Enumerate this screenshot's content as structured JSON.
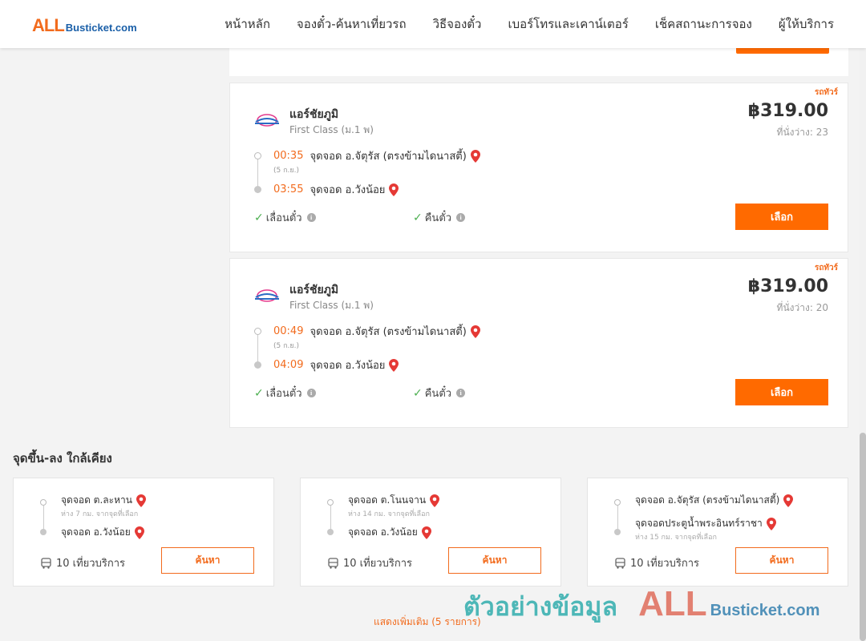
{
  "header": {
    "logo_a": "ALL",
    "logo_b": "Busticket.com",
    "nav": [
      "หน้าหลัก",
      "จองตั๋ว-ค้นหาเที่ยวรถ",
      "วิธีจองตั๋ว",
      "เบอร์โทรและเคาน์เตอร์",
      "เช็คสถานะการจอง",
      "ผู้ให้บริการ"
    ]
  },
  "trips": [
    {
      "tag": "รถทัวร์",
      "operator": "แอร์ชัยภูมิ",
      "class": "First Class (ม.1 พ)",
      "price": "฿319.00",
      "seats_label": "ที่นั่งว่าง:",
      "seats": "23",
      "depart_time": "00:35",
      "depart_stop": "จุดจอด อ.จัตุรัส (ตรงข้ามไดนาสตี้)",
      "depart_date": "(5 ก.ย.)",
      "arrive_time": "03:55",
      "arrive_stop": "จุดจอด อ.วังน้อย",
      "feature_1": "เลื่อนตั๋ว",
      "feature_2": "คืนตั๋ว",
      "select_label": "เลือก"
    },
    {
      "tag": "รถทัวร์",
      "operator": "แอร์ชัยภูมิ",
      "class": "First Class (ม.1 พ)",
      "price": "฿319.00",
      "seats_label": "ที่นั่งว่าง:",
      "seats": "20",
      "depart_time": "00:49",
      "depart_stop": "จุดจอด อ.จัตุรัส (ตรงข้ามไดนาสตี้)",
      "depart_date": "(5 ก.ย.)",
      "arrive_time": "04:09",
      "arrive_stop": "จุดจอด อ.วังน้อย",
      "feature_1": "เลื่อนตั๋ว",
      "feature_2": "คืนตั๋ว",
      "select_label": "เลือก"
    }
  ],
  "nearby": {
    "title": "จุดขึ้น-ลง ใกล้เคียง",
    "cards": [
      {
        "from": "จุดจอด ต.ละหาน",
        "from_sub": "ห่าง 7 กม. จากจุดที่เลือก",
        "to": "จุดจอด อ.วังน้อย",
        "to_sub": "",
        "count": "10 เที่ยวบริการ",
        "button": "ค้นหา"
      },
      {
        "from": "จุดจอด ต.โนนจาน",
        "from_sub": "ห่าง 14 กม. จากจุดที่เลือก",
        "to": "จุดจอด อ.วังน้อย",
        "to_sub": "",
        "count": "10 เที่ยวบริการ",
        "button": "ค้นหา"
      },
      {
        "from": "จุดจอด อ.จัตุรัส (ตรงข้ามไดนาสตี้)",
        "from_sub": "",
        "to": "จุดจอดประตูน้ำพระอินทร์ราชา",
        "to_sub": "ห่าง 15 กม. จากจุดที่เลือก",
        "count": "10 เที่ยวบริการ",
        "button": "ค้นหา"
      }
    ],
    "show_more": "แสดงเพิ่มเติม (5 รายการ)"
  },
  "watermark": {
    "th": "ตัวอย่างข้อมูล",
    "a": "ALL",
    "b": "Busticket.com"
  },
  "colors": {
    "accent": "#ff6a00",
    "text_orange": "#f26b1d",
    "check": "#4caf50"
  }
}
